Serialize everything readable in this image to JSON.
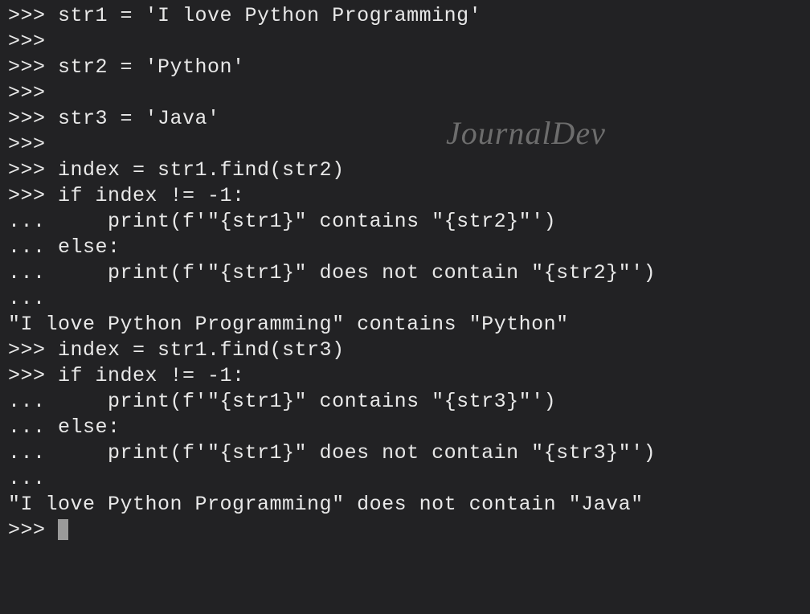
{
  "terminal": {
    "lines": [
      ">>> str1 = 'I love Python Programming'",
      ">>> ",
      ">>> str2 = 'Python'",
      ">>> ",
      ">>> str3 = 'Java'",
      ">>> ",
      ">>> index = str1.find(str2)",
      ">>> if index != -1:",
      "...     print(f'\"{str1}\" contains \"{str2}\"')",
      "... else:",
      "...     print(f'\"{str1}\" does not contain \"{str2}\"')",
      "... ",
      "\"I love Python Programming\" contains \"Python\"",
      ">>> index = str1.find(str3)",
      ">>> if index != -1:",
      "...     print(f'\"{str1}\" contains \"{str3}\"')",
      "... else:",
      "...     print(f'\"{str1}\" does not contain \"{str3}\"')",
      "... ",
      "\"I love Python Programming\" does not contain \"Java\"",
      ">>> "
    ]
  },
  "watermark": "JournalDev"
}
